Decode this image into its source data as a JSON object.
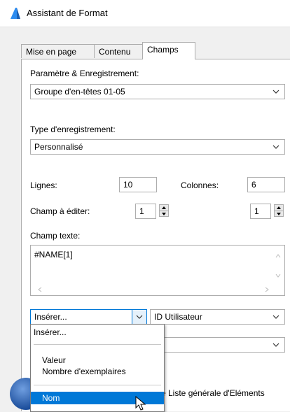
{
  "window": {
    "title": "Assistant de Format"
  },
  "tabs": [
    "Mise en page",
    "Contenu",
    "Champs"
  ],
  "param_label": "Paramètre & Enregistrement:",
  "param_value": "Groupe d'en-têtes 01-05",
  "type_label": "Type d'enregistrement:",
  "type_value": "Personnalisé",
  "lignes_label": "Lignes:",
  "lignes_value": "10",
  "colonnes_label": "Colonnes:",
  "colonnes_value": "6",
  "champ_edit_label": "Champ à éditer:",
  "champ_edit_value1": "1",
  "champ_edit_value2": "1",
  "champ_texte_label": "Champ texte:",
  "champ_texte_value": "#NAME[1]",
  "inserer_value": "Insérer...",
  "id_value": "ID Utilisateur",
  "dropdown_items": [
    "Insérer...",
    "Valeur",
    "Nombre d'exemplaires",
    "Nom"
  ],
  "bottom_text": "e Liste générale d'Eléments",
  "colors": {
    "accent": "#0078d7",
    "border": "#adadad"
  }
}
